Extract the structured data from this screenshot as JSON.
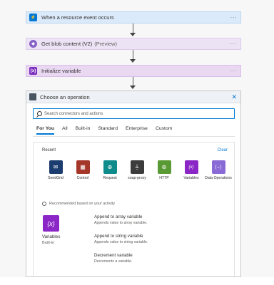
{
  "flow": {
    "steps": [
      {
        "title": "When a resource event occurs",
        "icon": "event-grid-icon",
        "menu": "···"
      },
      {
        "title": "Get blob content (V2)",
        "preview": "(Preview)",
        "icon": "blob-storage-icon",
        "menu": "···"
      },
      {
        "title": "Initialize variable",
        "icon": "variable-icon",
        "menu": "···"
      }
    ]
  },
  "panel": {
    "title": "Choose an operation",
    "close": "✕",
    "search_placeholder": "Search connectors and actions",
    "tabs": [
      "For You",
      "All",
      "Built-in",
      "Standard",
      "Enterprise",
      "Custom"
    ],
    "active_tab": "For You",
    "recent_label": "Recent",
    "clear_label": "Clear",
    "connectors": [
      {
        "label": "SendGrid",
        "color": "#1a3c6e",
        "glyph": "✉"
      },
      {
        "label": "Control",
        "color": "#a4372a",
        "glyph": "▦"
      },
      {
        "label": "Request",
        "color": "#0e8b8b",
        "glyph": "⊕"
      },
      {
        "label": "soap-proxy",
        "color": "#3c3c3c",
        "glyph": "⏚"
      },
      {
        "label": "HTTP",
        "color": "#5a9a35",
        "glyph": "⊛"
      },
      {
        "label": "Variables",
        "color": "#8b27c6",
        "glyph": "{x}"
      },
      {
        "label": "Data Operations",
        "color": "#8a6bd6",
        "glyph": "{⌄}"
      }
    ],
    "recommended_label": "Recommended based on your activity",
    "featured": {
      "name": "Variables",
      "sub": "Built-in",
      "glyph": "{x}"
    },
    "actions": [
      {
        "title": "Append to array variable",
        "desc": "Appends value to array variable."
      },
      {
        "title": "Append to string variable",
        "desc": "Appends value to string variable."
      },
      {
        "title": "Decrement variable",
        "desc": "Decrements a variable."
      }
    ]
  }
}
